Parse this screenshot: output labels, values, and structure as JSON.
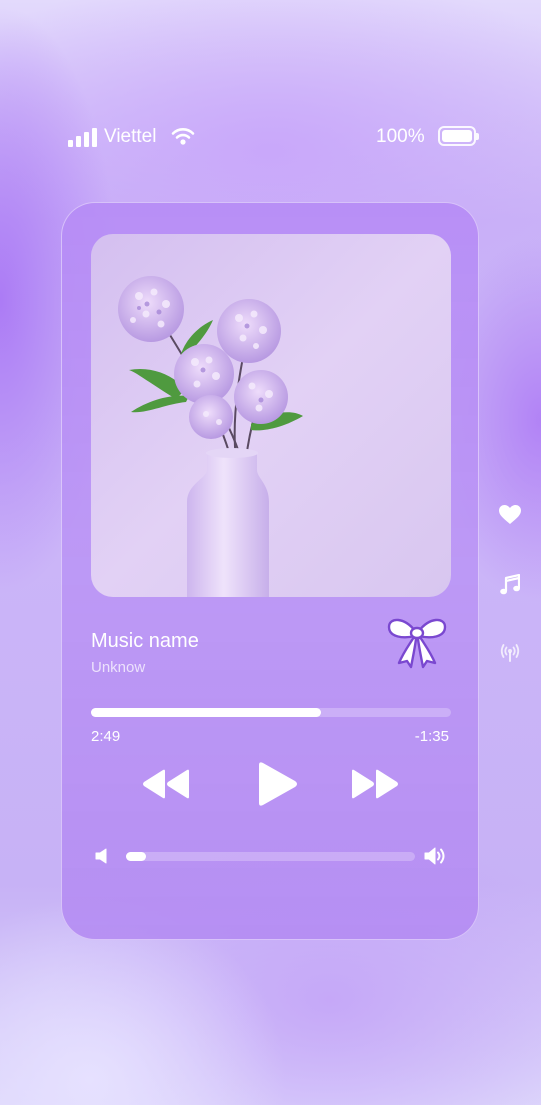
{
  "status_bar": {
    "carrier": "Viettel",
    "battery_percent": "100%",
    "battery_level": 1.0,
    "signal_bars": 4
  },
  "player": {
    "track_title": "Music name",
    "artist": "Unknow",
    "time_elapsed": "2:49",
    "time_remaining": "-1:35",
    "progress_fraction": 0.64,
    "volume_fraction": 0.07
  },
  "side_actions": [
    {
      "icon": "heart-icon"
    },
    {
      "icon": "music-note-icon"
    },
    {
      "icon": "broadcast-icon"
    }
  ],
  "colors": {
    "accent": "#b48cf5",
    "text": "#ffffff",
    "side_icon": "#ffffff"
  }
}
